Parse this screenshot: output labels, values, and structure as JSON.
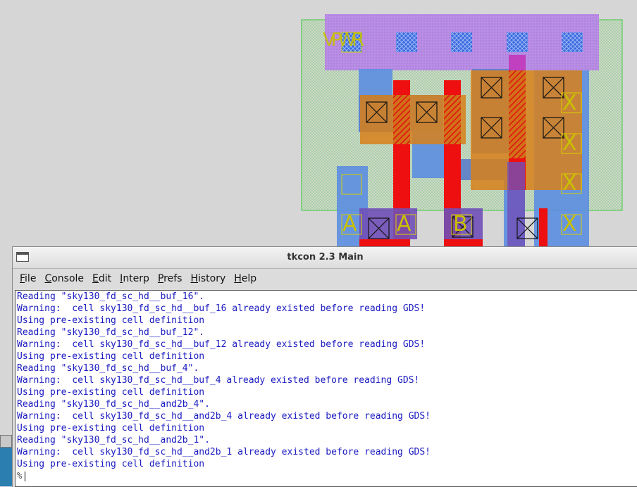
{
  "layout_view": {
    "labels": {
      "power_rail": "VPWR",
      "input_a": "A",
      "input_a2": "A",
      "input_b": "B",
      "output_x": "X"
    },
    "colors": {
      "background": "#d6d6d6",
      "nwell": "#8ccf8c",
      "metal1": "#b070e8",
      "local_interconnect": "#5c8ee0",
      "poly": "#ee1010",
      "diffusion": "#d8801a",
      "label": "#c9c000"
    }
  },
  "window": {
    "title": "tkcon 2.3 Main",
    "menu": [
      {
        "label": "File",
        "underline": "F",
        "rest": "ile"
      },
      {
        "label": "Console",
        "underline": "C",
        "rest": "onsole"
      },
      {
        "label": "Edit",
        "underline": "E",
        "rest": "dit"
      },
      {
        "label": "Interp",
        "underline": "I",
        "rest": "nterp"
      },
      {
        "label": "Prefs",
        "underline": "P",
        "rest": "refs"
      },
      {
        "label": "History",
        "underline": "H",
        "rest": "istory"
      },
      {
        "label": "Help",
        "underline": "H",
        "rest": "elp"
      }
    ],
    "console_lines": [
      "Reading \"sky130_fd_sc_hd__buf_16\".",
      "Warning:  cell sky130_fd_sc_hd__buf_16 already existed before reading GDS!",
      "Using pre-existing cell definition",
      "Reading \"sky130_fd_sc_hd__buf_12\".",
      "Warning:  cell sky130_fd_sc_hd__buf_12 already existed before reading GDS!",
      "Using pre-existing cell definition",
      "Reading \"sky130_fd_sc_hd__buf_4\".",
      "Warning:  cell sky130_fd_sc_hd__buf_4 already existed before reading GDS!",
      "Using pre-existing cell definition",
      "Reading \"sky130_fd_sc_hd__and2b_4\".",
      "Warning:  cell sky130_fd_sc_hd__and2b_4 already existed before reading GDS!",
      "Using pre-existing cell definition",
      "Reading \"sky130_fd_sc_hd__and2b_1\".",
      "Warning:  cell sky130_fd_sc_hd__and2b_1 already existed before reading GDS!",
      "Using pre-existing cell definition"
    ],
    "prompt": "%",
    "colors": {
      "console_text": "#1a1ac0",
      "console_bg": "#ffffff",
      "window_bg": "#dcdcdc"
    }
  }
}
